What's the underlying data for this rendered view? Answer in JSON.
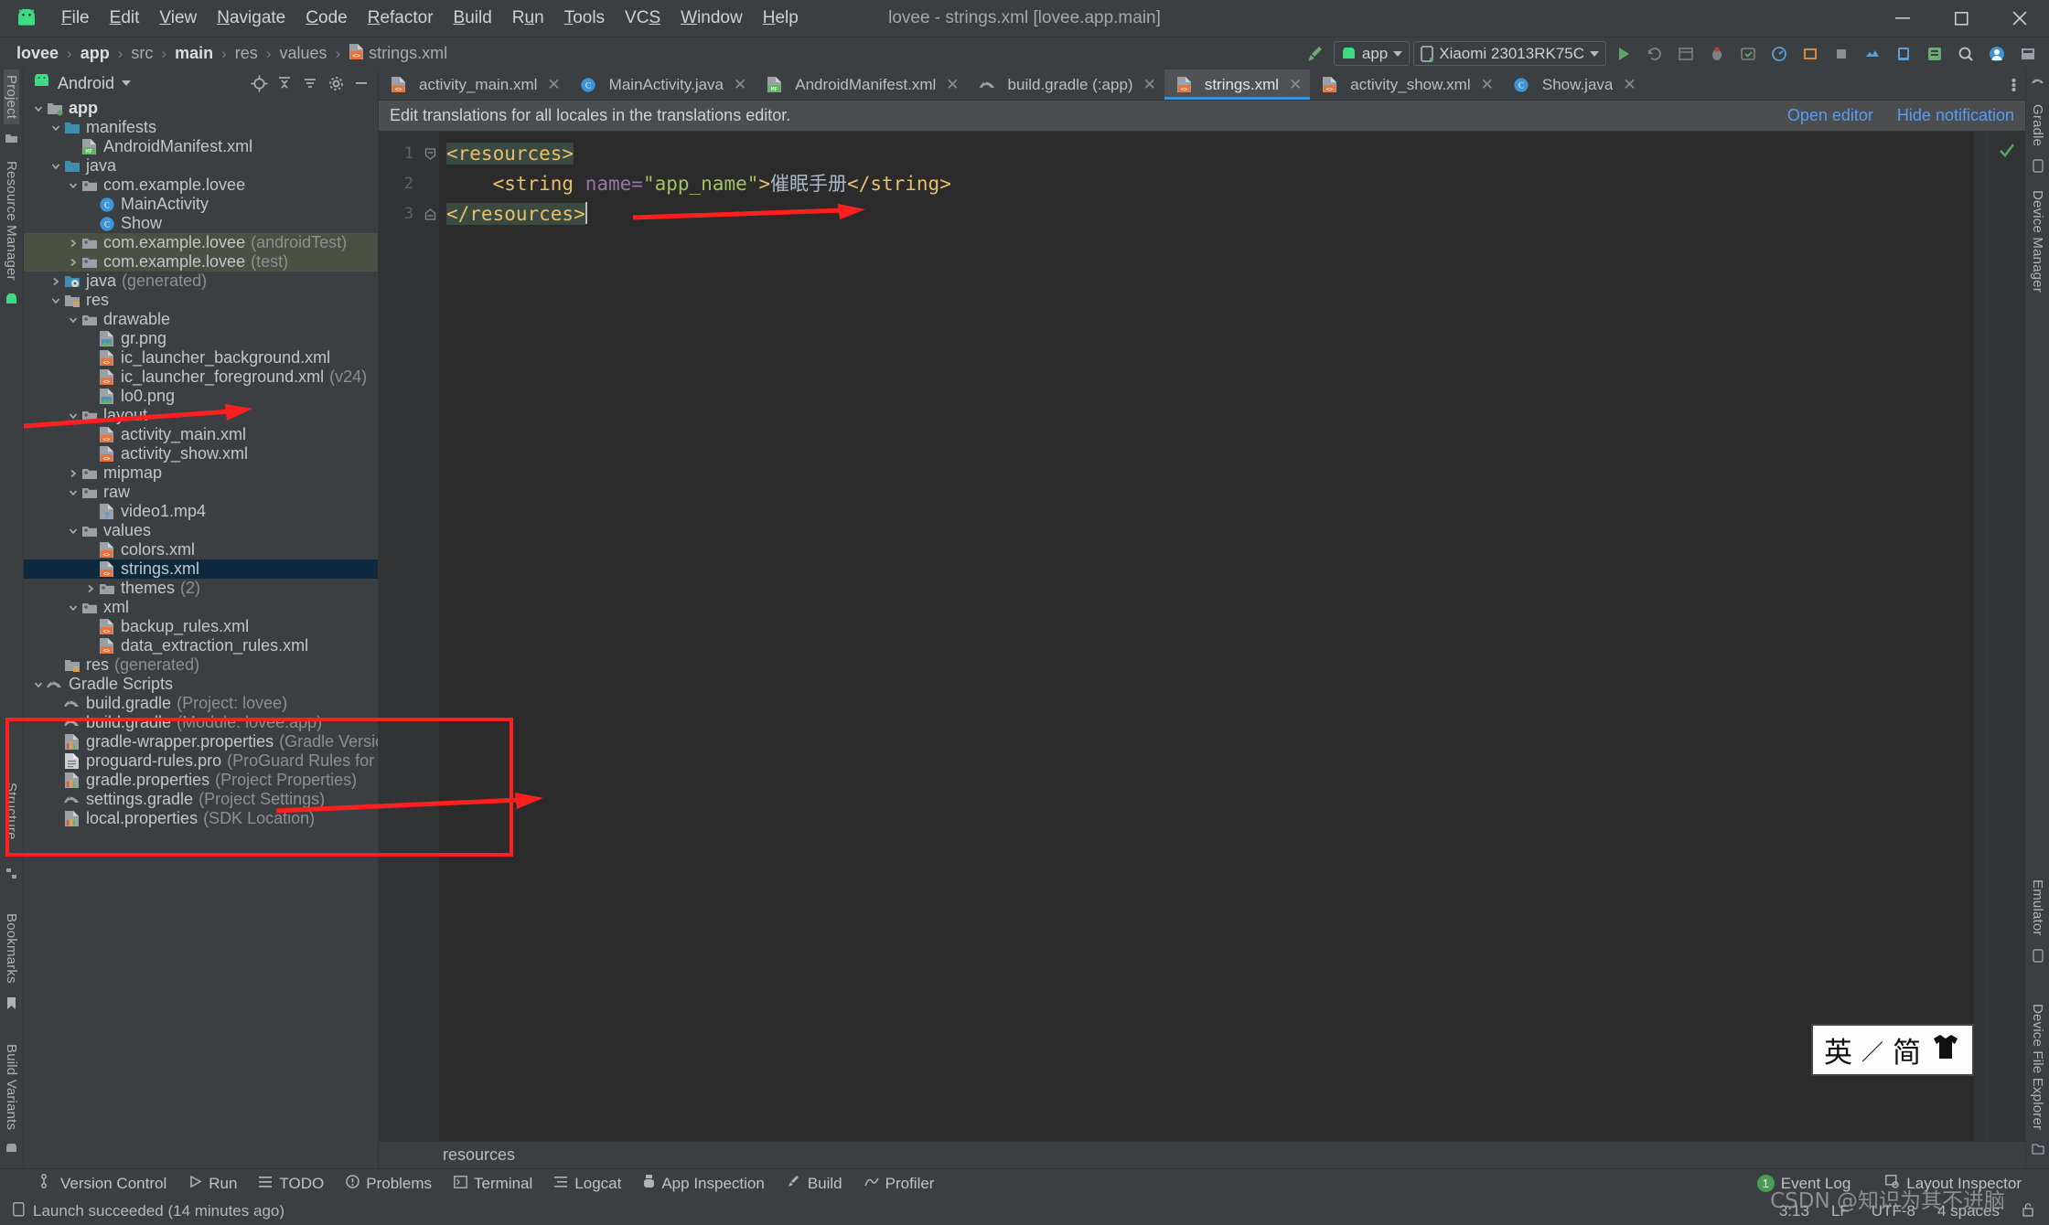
{
  "window": {
    "title": "lovee - strings.xml [lovee.app.main]",
    "app_icon": "android-droid-icon",
    "controls": {
      "minimize": "—",
      "maximize": "❐",
      "close": "✕"
    }
  },
  "menubar": {
    "items": [
      {
        "label": "File",
        "mnemonic": "F"
      },
      {
        "label": "Edit",
        "mnemonic": "E"
      },
      {
        "label": "View",
        "mnemonic": "V"
      },
      {
        "label": "Navigate",
        "mnemonic": "N"
      },
      {
        "label": "Code",
        "mnemonic": "C"
      },
      {
        "label": "Refactor",
        "mnemonic": "R"
      },
      {
        "label": "Build",
        "mnemonic": "B"
      },
      {
        "label": "Run",
        "mnemonic": "u"
      },
      {
        "label": "Tools",
        "mnemonic": "T"
      },
      {
        "label": "VCS",
        "mnemonic": "S"
      },
      {
        "label": "Window",
        "mnemonic": "W"
      },
      {
        "label": "Help",
        "mnemonic": "H"
      }
    ]
  },
  "breadcrumb": {
    "items": [
      {
        "label": "lovee",
        "bold": true
      },
      {
        "label": "app",
        "bold": true
      },
      {
        "label": "src",
        "bold": false
      },
      {
        "label": "main",
        "bold": true
      },
      {
        "label": "res",
        "bold": false
      },
      {
        "label": "values",
        "bold": false
      },
      {
        "label": "strings.xml",
        "bold": false,
        "icon": "xml-file-icon"
      }
    ],
    "separator": "›"
  },
  "toolbar": {
    "build_icon": "build-hammer-icon",
    "module_selector": "app",
    "device_selector": "Xiaomi 23013RK75C",
    "run_label": "run-button",
    "actions": [
      "run-icon",
      "rerun-icon",
      "apply-changes-icon",
      "debug-icon",
      "apply-code-changes-icon",
      "profiler-icon",
      "device-manager-icon",
      "stop-icon",
      "sdk-manager-icon",
      "avd-manager-icon",
      "device-file-explorer-icon",
      "search-icon",
      "account-icon",
      "settings-icon"
    ]
  },
  "left_rail": {
    "items": [
      "Project",
      "Resource Manager"
    ]
  },
  "left_rail_bottom": {
    "items": [
      "Structure",
      "Bookmarks",
      "Build Variants"
    ]
  },
  "right_rail": {
    "items": [
      "Gradle",
      "Device Manager",
      "Emulator",
      "Device File Explorer"
    ]
  },
  "project_panel": {
    "view_name": "Android",
    "view_icon": "android-droid-icon",
    "dropdown_icon": "chevron-down-icon",
    "tool_icons": [
      "locate-icon",
      "collapse-all-icon",
      "sort-icon",
      "settings-icon",
      "hide-icon"
    ],
    "tree": [
      {
        "depth": 0,
        "arrow": "down",
        "icon": "module-icon",
        "label": "app",
        "bold": true
      },
      {
        "depth": 1,
        "arrow": "down",
        "icon": "folder-icon",
        "label": "manifests"
      },
      {
        "depth": 2,
        "arrow": "none",
        "icon": "manifest-file-icon",
        "label": "AndroidManifest.xml"
      },
      {
        "depth": 1,
        "arrow": "down",
        "icon": "folder-icon",
        "label": "java"
      },
      {
        "depth": 2,
        "arrow": "down",
        "icon": "package-icon",
        "label": "com.example.lovee"
      },
      {
        "depth": 3,
        "arrow": "none",
        "icon": "java-class-icon",
        "label": "MainActivity"
      },
      {
        "depth": 3,
        "arrow": "none",
        "icon": "java-class-icon",
        "label": "Show"
      },
      {
        "depth": 2,
        "arrow": "right",
        "icon": "package-icon",
        "label": "com.example.lovee",
        "muted": "(androidTest)",
        "style": "test"
      },
      {
        "depth": 2,
        "arrow": "right",
        "icon": "package-icon",
        "label": "com.example.lovee",
        "muted": "(test)",
        "style": "test"
      },
      {
        "depth": 1,
        "arrow": "right",
        "icon": "generated-folder-icon",
        "label": "java",
        "muted": "(generated)"
      },
      {
        "depth": 1,
        "arrow": "down",
        "icon": "res-folder-icon",
        "label": "res"
      },
      {
        "depth": 2,
        "arrow": "down",
        "icon": "package-icon",
        "label": "drawable"
      },
      {
        "depth": 3,
        "arrow": "none",
        "icon": "png-file-icon",
        "label": "gr.png"
      },
      {
        "depth": 3,
        "arrow": "none",
        "icon": "xml-file-icon",
        "label": "ic_launcher_background.xml"
      },
      {
        "depth": 3,
        "arrow": "none",
        "icon": "xml-file-icon",
        "label": "ic_launcher_foreground.xml",
        "muted": "(v24)"
      },
      {
        "depth": 3,
        "arrow": "none",
        "icon": "png-file-icon",
        "label": "lo0.png"
      },
      {
        "depth": 2,
        "arrow": "down",
        "icon": "package-icon",
        "label": "layout"
      },
      {
        "depth": 3,
        "arrow": "none",
        "icon": "xml-file-icon",
        "label": "activity_main.xml"
      },
      {
        "depth": 3,
        "arrow": "none",
        "icon": "xml-file-icon",
        "label": "activity_show.xml"
      },
      {
        "depth": 2,
        "arrow": "right",
        "icon": "package-icon",
        "label": "mipmap"
      },
      {
        "depth": 2,
        "arrow": "down",
        "icon": "package-icon",
        "label": "raw"
      },
      {
        "depth": 3,
        "arrow": "none",
        "icon": "unknown-file-icon",
        "label": "video1.mp4"
      },
      {
        "depth": 2,
        "arrow": "down",
        "icon": "package-icon",
        "label": "values"
      },
      {
        "depth": 3,
        "arrow": "none",
        "icon": "xml-file-icon",
        "label": "colors.xml"
      },
      {
        "depth": 3,
        "arrow": "none",
        "icon": "xml-file-icon",
        "label": "strings.xml",
        "style": "selected"
      },
      {
        "depth": 3,
        "arrow": "right",
        "icon": "package-icon",
        "label": "themes",
        "muted": "(2)"
      },
      {
        "depth": 2,
        "arrow": "down",
        "icon": "package-icon",
        "label": "xml"
      },
      {
        "depth": 3,
        "arrow": "none",
        "icon": "xml-file-icon",
        "label": "backup_rules.xml"
      },
      {
        "depth": 3,
        "arrow": "none",
        "icon": "xml-file-icon",
        "label": "data_extraction_rules.xml"
      },
      {
        "depth": 1,
        "arrow": "none",
        "icon": "generated-res-icon",
        "label": "res",
        "muted": "(generated)"
      },
      {
        "depth": 0,
        "arrow": "down",
        "icon": "gradle-icon",
        "label": "Gradle Scripts"
      },
      {
        "depth": 1,
        "arrow": "none",
        "icon": "gradle-icon",
        "label": "build.gradle",
        "muted": "(Project: lovee)"
      },
      {
        "depth": 1,
        "arrow": "none",
        "icon": "gradle-icon",
        "label": "build.gradle",
        "muted": "(Module: lovee.app)"
      },
      {
        "depth": 1,
        "arrow": "none",
        "icon": "properties-file-icon",
        "label": "gradle-wrapper.properties",
        "muted": "(Gradle Version)"
      },
      {
        "depth": 1,
        "arrow": "none",
        "icon": "text-file-icon",
        "label": "proguard-rules.pro",
        "muted": "(ProGuard Rules for lovee.app)"
      },
      {
        "depth": 1,
        "arrow": "none",
        "icon": "properties-file-icon",
        "label": "gradle.properties",
        "muted": "(Project Properties)"
      },
      {
        "depth": 1,
        "arrow": "none",
        "icon": "gradle-icon",
        "label": "settings.gradle",
        "muted": "(Project Settings)"
      },
      {
        "depth": 1,
        "arrow": "none",
        "icon": "properties-file-icon",
        "label": "local.properties",
        "muted": "(SDK Location)"
      }
    ]
  },
  "editor": {
    "tabs": [
      {
        "label": "activity_main.xml",
        "icon": "xml-file-icon",
        "active": false
      },
      {
        "label": "MainActivity.java",
        "icon": "java-class-icon",
        "active": false
      },
      {
        "label": "AndroidManifest.xml",
        "icon": "manifest-file-icon",
        "active": false
      },
      {
        "label": "build.gradle (:app)",
        "icon": "gradle-icon",
        "active": false
      },
      {
        "label": "strings.xml",
        "icon": "xml-file-icon",
        "active": true
      },
      {
        "label": "activity_show.xml",
        "icon": "xml-file-icon",
        "active": false
      },
      {
        "label": "Show.java",
        "icon": "java-class-icon",
        "active": false
      }
    ],
    "tab_close_glyph": "✕",
    "overflow_icon": "more-options-icon",
    "notification": {
      "message": "Edit translations for all locales in the translations editor.",
      "open_editor": "Open editor",
      "hide_notification": "Hide notification"
    },
    "gutter_lines": [
      "1",
      "2",
      "3"
    ],
    "code_lines": [
      {
        "n": 1,
        "segments": [
          {
            "t": "<resources>",
            "c": "tag",
            "hl": true
          }
        ]
      },
      {
        "n": 2,
        "segments": [
          {
            "t": "    ",
            "c": "txt"
          },
          {
            "t": "<string ",
            "c": "tag"
          },
          {
            "t": "name=",
            "c": "attr"
          },
          {
            "t": "\"app_name\"",
            "c": "str"
          },
          {
            "t": ">",
            "c": "tag"
          },
          {
            "t": "催眠手册",
            "c": "txt"
          },
          {
            "t": "</string>",
            "c": "tag"
          }
        ]
      },
      {
        "n": 3,
        "segments": [
          {
            "t": "</resources>",
            "c": "tag",
            "hl": true
          }
        ]
      }
    ],
    "status_ok_icon": "inspection-ok-icon",
    "bottom_breadcrumb": "resources"
  },
  "tool_windows": {
    "left": [
      {
        "label": "Version Control",
        "icon": "version-control-icon"
      },
      {
        "label": "Run",
        "icon": "run-icon"
      },
      {
        "label": "TODO",
        "icon": "todo-icon"
      },
      {
        "label": "Problems",
        "icon": "problems-icon"
      },
      {
        "label": "Terminal",
        "icon": "terminal-icon"
      },
      {
        "label": "Logcat",
        "icon": "logcat-icon"
      },
      {
        "label": "App Inspection",
        "icon": "app-inspection-icon"
      },
      {
        "label": "Build",
        "icon": "build-hammer-icon"
      },
      {
        "label": "Profiler",
        "icon": "profiler-icon"
      }
    ],
    "right": [
      {
        "label": "Event Log",
        "icon": "event-log-icon",
        "badge": "1"
      },
      {
        "label": "Layout Inspector",
        "icon": "layout-inspector-icon"
      }
    ]
  },
  "status_bar": {
    "icon": "device-icon",
    "message": "Launch succeeded (14 minutes ago)",
    "caret_position": "3:13",
    "line_separator": "LF",
    "encoding": "UTF-8",
    "indent": "4 spaces",
    "lock_icon": "unlocked-icon"
  },
  "overlays": {
    "ime_indicator": {
      "mode": "英",
      "separator": "／",
      "script": "简",
      "icon": "shirt-icon"
    },
    "watermark": "CSDN @知识为其不进脑",
    "annotation_color": "#ff1f1f"
  }
}
